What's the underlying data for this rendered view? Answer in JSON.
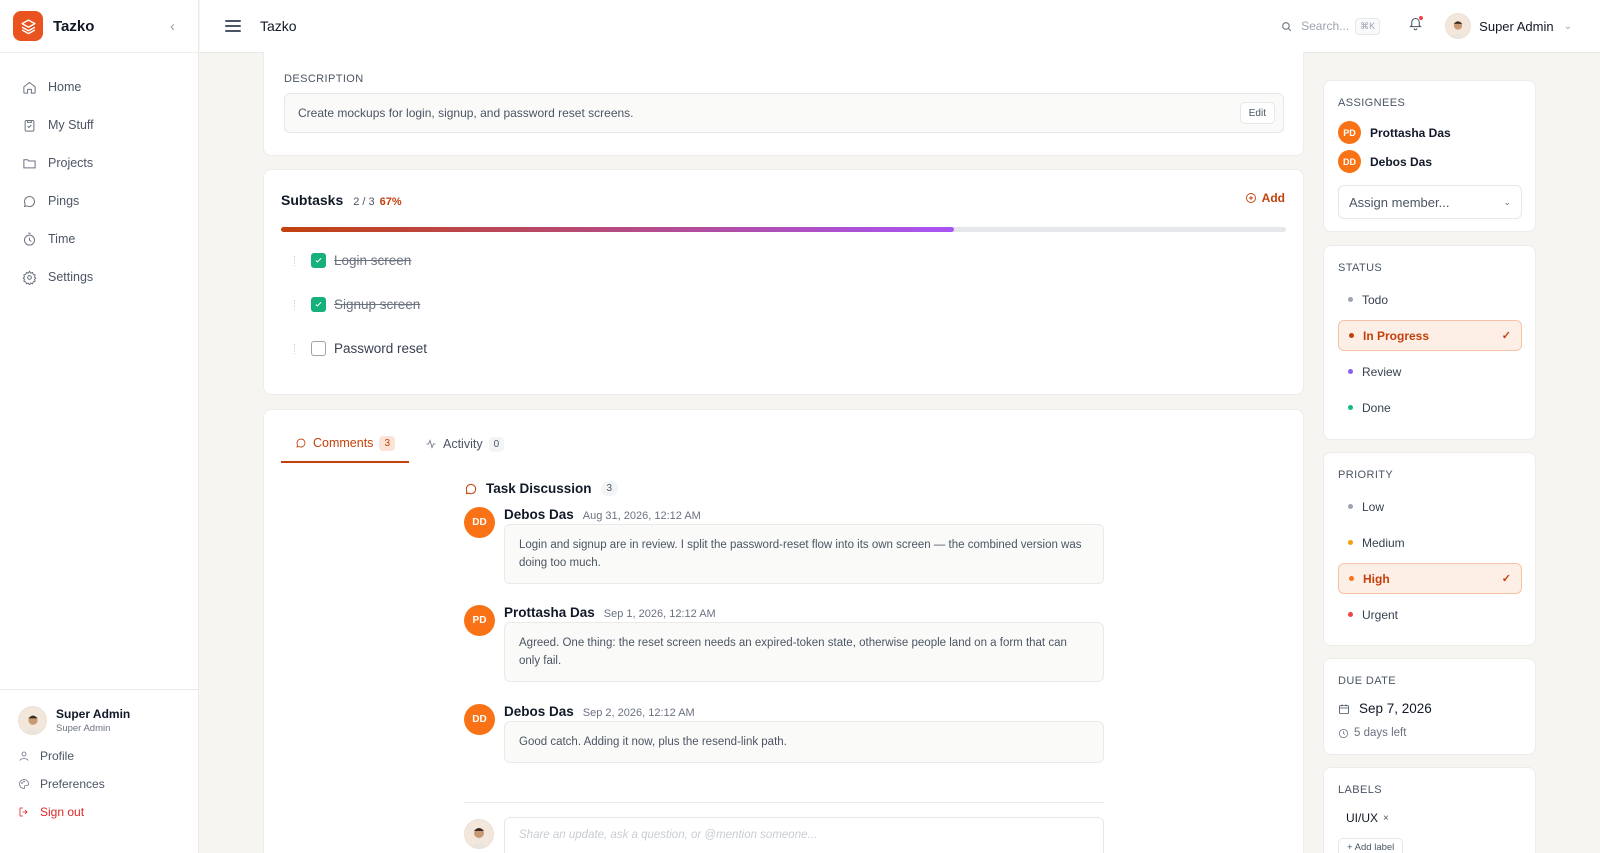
{
  "app": {
    "name": "Tazko"
  },
  "sidebar": {
    "items": [
      {
        "label": "Home",
        "icon": "home-icon"
      },
      {
        "label": "My Stuff",
        "icon": "clipboard-icon"
      },
      {
        "label": "Projects",
        "icon": "folder-icon"
      },
      {
        "label": "Pings",
        "icon": "chat-icon"
      },
      {
        "label": "Time",
        "icon": "timer-icon"
      },
      {
        "label": "Settings",
        "icon": "gear-icon"
      }
    ],
    "user": {
      "name": "Super Admin",
      "role": "Super Admin"
    },
    "links": {
      "profile": "Profile",
      "preferences": "Preferences",
      "signout": "Sign out"
    }
  },
  "topbar": {
    "title": "Tazko",
    "search_placeholder": "Search...",
    "shortcut": "⌘K",
    "user": "Super Admin"
  },
  "description": {
    "label": "DESCRIPTION",
    "text": "Create mockups for login, signup, and password reset screens.",
    "edit_label": "Edit"
  },
  "subtasks": {
    "title": "Subtasks",
    "count": "2 / 3",
    "percent_label": "67%",
    "progress": 0.67,
    "add_label": "Add",
    "items": [
      {
        "label": "Login screen",
        "done": true
      },
      {
        "label": "Signup screen",
        "done": true
      },
      {
        "label": "Password reset",
        "done": false
      }
    ]
  },
  "tabs": {
    "comments": {
      "label": "Comments",
      "count": "3"
    },
    "activity": {
      "label": "Activity",
      "count": "0"
    }
  },
  "discussion": {
    "title": "Task Discussion",
    "count": "3",
    "comments": [
      {
        "initials": "DD",
        "author": "Debos Das",
        "time": "Aug 31, 2026, 12:12 AM",
        "text": "Login and signup are in review. I split the password-reset flow into its own screen — the combined version was doing too much."
      },
      {
        "initials": "PD",
        "author": "Prottasha Das",
        "time": "Sep 1, 2026, 12:12 AM",
        "text": "Agreed. One thing: the reset screen needs an expired-token state, otherwise people land on a form that can only fail."
      },
      {
        "initials": "DD",
        "author": "Debos Das",
        "time": "Sep 2, 2026, 12:12 AM",
        "text": "Good catch. Adding it now, plus the resend-link path."
      }
    ],
    "reply_placeholder": "Share an update, ask a question, or @mention someone..."
  },
  "assignees": {
    "label": "ASSIGNEES",
    "people": [
      {
        "initials": "PD",
        "name": "Prottasha Das"
      },
      {
        "initials": "DD",
        "name": "Debos Das"
      }
    ],
    "assign_placeholder": "Assign member..."
  },
  "status": {
    "label": "STATUS",
    "options": [
      {
        "label": "Todo",
        "color": "#9ca3af"
      },
      {
        "label": "In Progress",
        "color": "#c2410c"
      },
      {
        "label": "Review",
        "color": "#8b5cf6"
      },
      {
        "label": "Done",
        "color": "#10b981"
      }
    ],
    "selected": "In Progress"
  },
  "priority": {
    "label": "PRIORITY",
    "options": [
      {
        "label": "Low",
        "color": "#9ca3af"
      },
      {
        "label": "Medium",
        "color": "#f59e0b"
      },
      {
        "label": "High",
        "color": "#f97316"
      },
      {
        "label": "Urgent",
        "color": "#ef4444"
      }
    ],
    "selected": "High"
  },
  "due_date": {
    "label": "DUE DATE",
    "date": "Sep 7, 2026",
    "remaining": "5 days left"
  },
  "labels": {
    "label": "LABELS",
    "items": [
      "UI/UX"
    ],
    "add_label": "+ Add label"
  },
  "colors": {
    "accent": "#e8531f",
    "accent_text": "#c2410c",
    "success": "#16b07a"
  }
}
